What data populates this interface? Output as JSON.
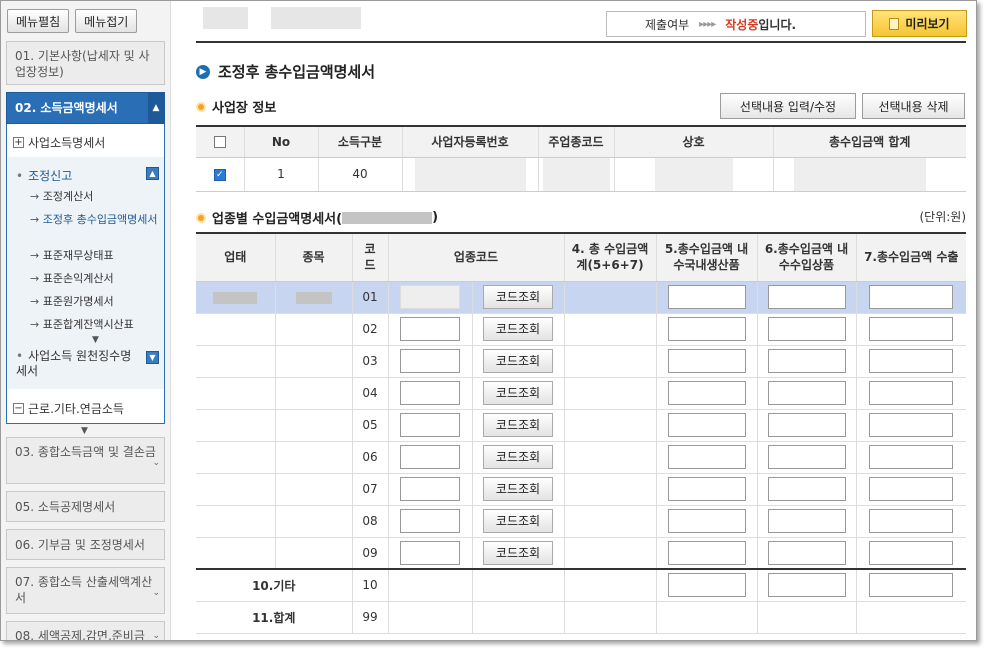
{
  "sidebar": {
    "buttons": {
      "expand": "메뉴펼침",
      "collapse": "메뉴접기"
    },
    "menu": {
      "m01": "01. 기본사항(납세자 및 사업장정보)",
      "m02": "02. 소득금액명세서",
      "m03": "03. 종합소득금액 및 결손금",
      "m05": "05. 소득공제명세서",
      "m06": "06. 기부금 및 조정명세서",
      "m07": "07. 종합소득 산출세액계산서",
      "m08": "08. 세액공제,감면,준비금"
    },
    "sub": {
      "business_income": "사업소득명세서",
      "adjust_title": "조정신고",
      "adjust_items": [
        "조정계산서",
        "조정후 총수입금액명세서",
        "표준재무상태표",
        "표준손익계산서",
        "표준원가명세서",
        "표준합계잔액시산표"
      ],
      "withholding": "사업소득 원천징수명세서",
      "other_income": "근로.기타.연금소득"
    }
  },
  "status": {
    "label": "제출여부",
    "arrows": "▸▸▸▸",
    "state": "작성중",
    "suffix": "입니다."
  },
  "preview_label": "미리보기",
  "page_title": "조정후 총수입금액명세서",
  "section1": {
    "title": "사업장 정보",
    "btn_edit": "선택내용 입력/수정",
    "btn_delete": "선택내용 삭제",
    "headers": [
      "No",
      "소득구분",
      "사업자등록번호",
      "주업종코드",
      "상호",
      "총수입금액 합계"
    ],
    "row": {
      "no": "1",
      "income_type": "40"
    }
  },
  "section2": {
    "title": "업종별 수입금액명세서(",
    "title_end": ")",
    "unit": "(단위:원)",
    "headers": {
      "h1": "업태",
      "h2": "종목",
      "h3": "코드",
      "h4": "업종코드",
      "h5": "4. 총 수입금액계(5+6+7)",
      "h6": "5.총수입금액 내수국내생산품",
      "h7": "6.총수입금액 내수수입상품",
      "h8": "7.총수입금액 수출"
    },
    "code_btn": "코드조회",
    "rows": [
      "01",
      "02",
      "03",
      "04",
      "05",
      "06",
      "07",
      "08",
      "09"
    ],
    "etc": {
      "label": "10.기타",
      "code": "10"
    },
    "total": {
      "label": "11.합계",
      "code": "99"
    }
  }
}
